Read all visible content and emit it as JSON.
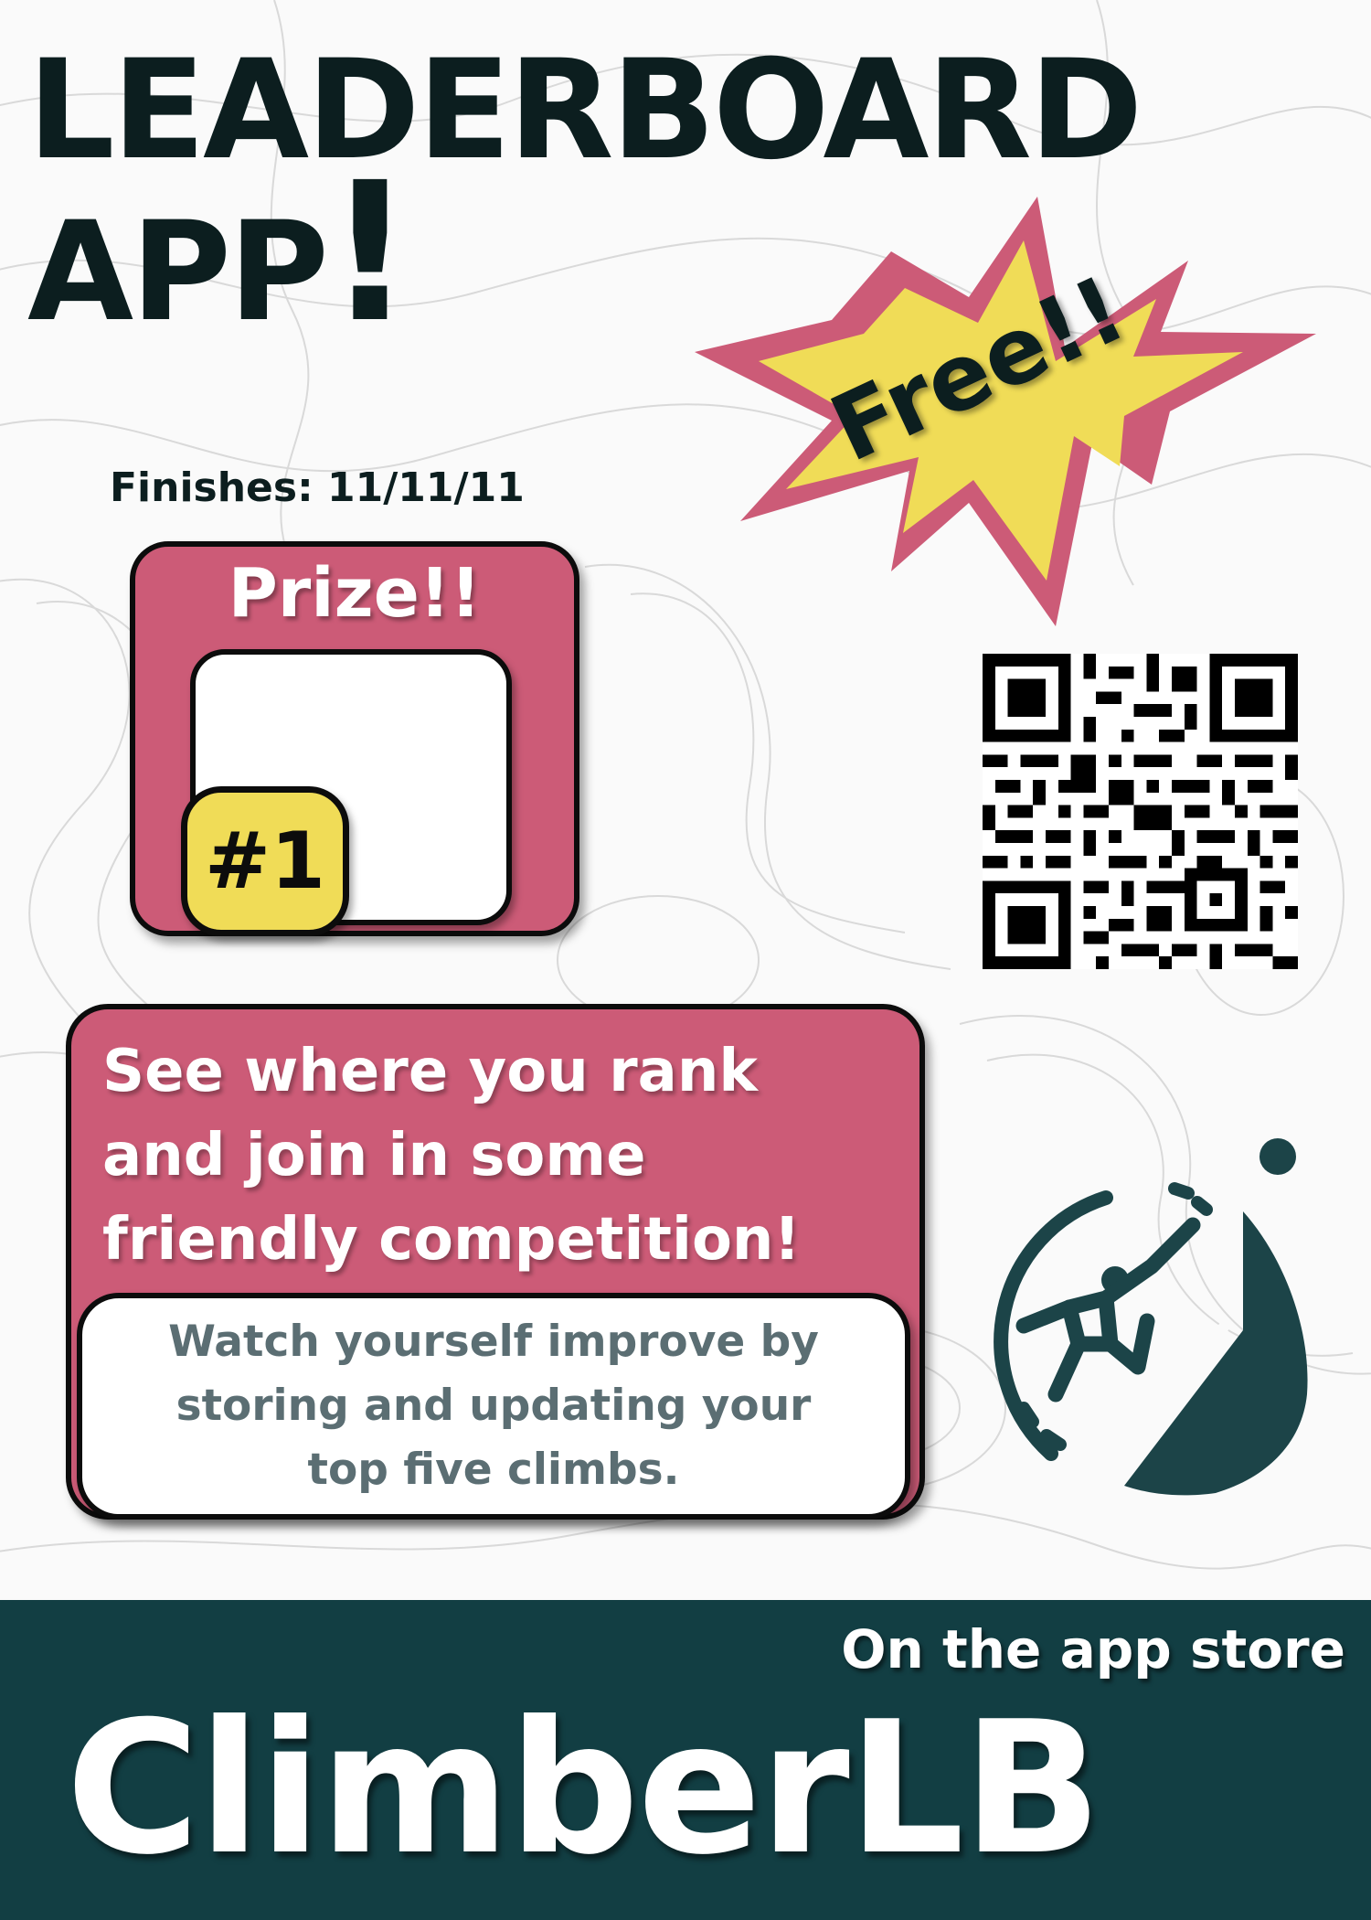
{
  "poster": {
    "title_line1": "LEADERBOARD",
    "title_line2": "APP",
    "title_exclaim": "!",
    "finishes": "Finishes: 11/11/11",
    "free_label": "Free!!",
    "prize": {
      "title": "Prize!!",
      "rank": "#1"
    },
    "promo": {
      "headline_line1": "See where you rank",
      "headline_line2": "and join in some",
      "headline_line3": "friendly competition!",
      "subtext_line1": "Watch yourself improve by",
      "subtext_line2": "storing and updating your",
      "subtext_line3": "top five climbs."
    },
    "footer": {
      "store_text": "On the app store",
      "brand": "ClimberLB"
    },
    "icons": {
      "qr": "qr-code-icon",
      "logo": "climber-logo-icon"
    },
    "colors": {
      "dark_teal": "#123e43",
      "logo_teal": "#1c4448",
      "pink": "#cc5b77",
      "yellow": "#f0dc57",
      "ink": "#0c1e1f",
      "sub_text": "#5b6e73"
    }
  }
}
